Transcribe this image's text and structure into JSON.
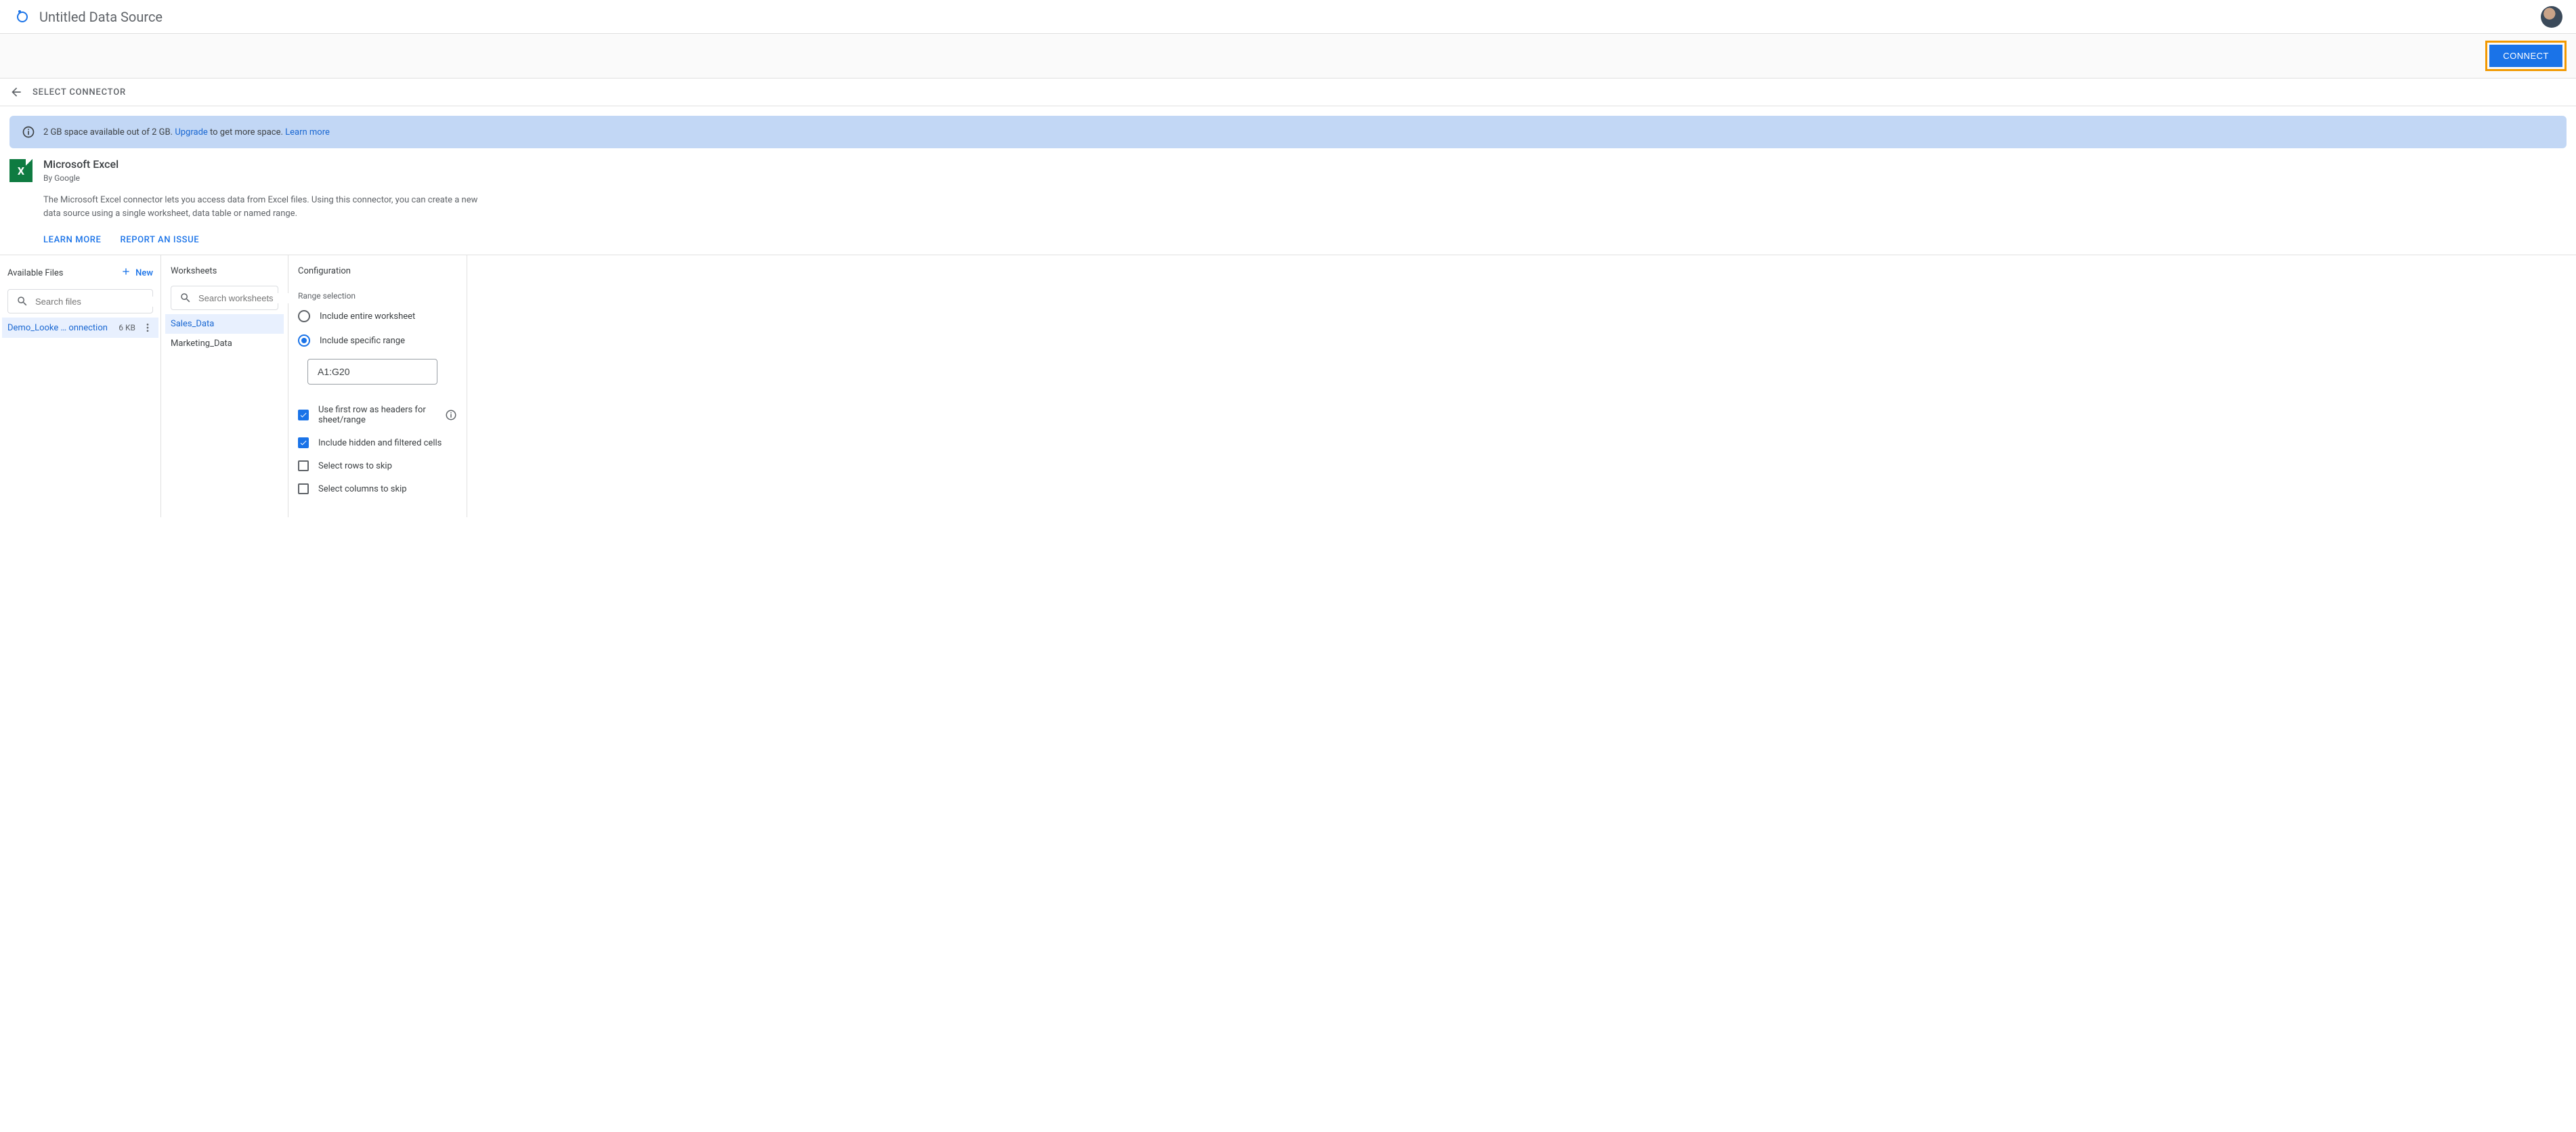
{
  "header": {
    "title": "Untitled Data Source"
  },
  "action_bar": {
    "connect_label": "CONNECT"
  },
  "back_nav": {
    "label": "SELECT CONNECTOR"
  },
  "banner": {
    "text1": "2 GB space available out of 2 GB.",
    "upgrade": "Upgrade",
    "text2": "to get more space.",
    "learn_more": "Learn more"
  },
  "connector": {
    "name": "Microsoft Excel",
    "by": "By Google",
    "desc": "The Microsoft Excel connector lets you access data from Excel files. Using this connector, you can create a new data source using a single worksheet, data table or named range.",
    "learn_more": "LEARN MORE",
    "report_issue": "REPORT AN ISSUE"
  },
  "files": {
    "heading": "Available Files",
    "new_label": "New",
    "search_placeholder": "Search files",
    "items": [
      {
        "name": "Demo_Looke … onnection",
        "size": "6 KB"
      }
    ]
  },
  "worksheets": {
    "heading": "Worksheets",
    "search_placeholder": "Search worksheets",
    "items": [
      {
        "name": "Sales_Data"
      },
      {
        "name": "Marketing_Data"
      }
    ]
  },
  "config": {
    "heading": "Configuration",
    "range_selection_label": "Range selection",
    "radio_entire": "Include entire worksheet",
    "radio_specific": "Include specific range",
    "range_value": "A1:G20",
    "check_headers": "Use first row as headers for sheet/range",
    "check_hidden": "Include hidden and filtered cells",
    "check_rows_skip": "Select rows to skip",
    "check_cols_skip": "Select columns to skip"
  }
}
